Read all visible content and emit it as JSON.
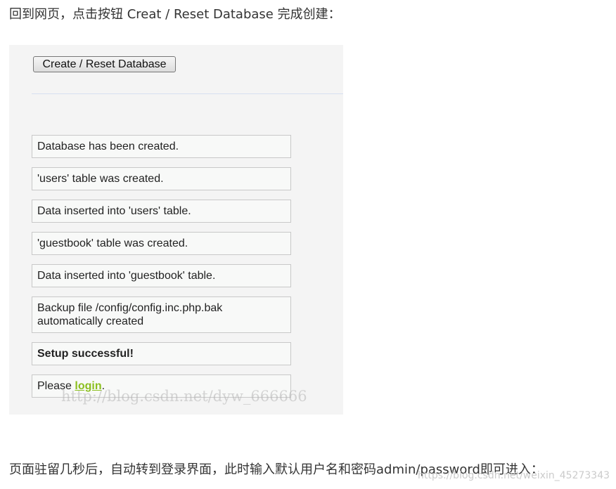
{
  "intro": "回到网页，点击按钮 Creat / Reset Database 完成创建：",
  "screenshot": {
    "button": "Create / Reset Database",
    "messages": [
      "Database has been created.",
      "'users' table was created.",
      "Data inserted into 'users' table.",
      "'guestbook' table was created.",
      "Data inserted into 'guestbook' table.",
      "Backup file /config/config.inc.php.bak automatically created"
    ],
    "success": "Setup successful!",
    "login_prefix": "Please ",
    "login_link": "login",
    "login_suffix": ".",
    "watermark": "http://blog.csdn.net/dyw_666666"
  },
  "outro": "页面驻留几秒后，自动转到登录界面，此时输入默认用户名和密码admin/password即可进入：",
  "watermark": "https://blog.csdn.net/weixin_45273343"
}
